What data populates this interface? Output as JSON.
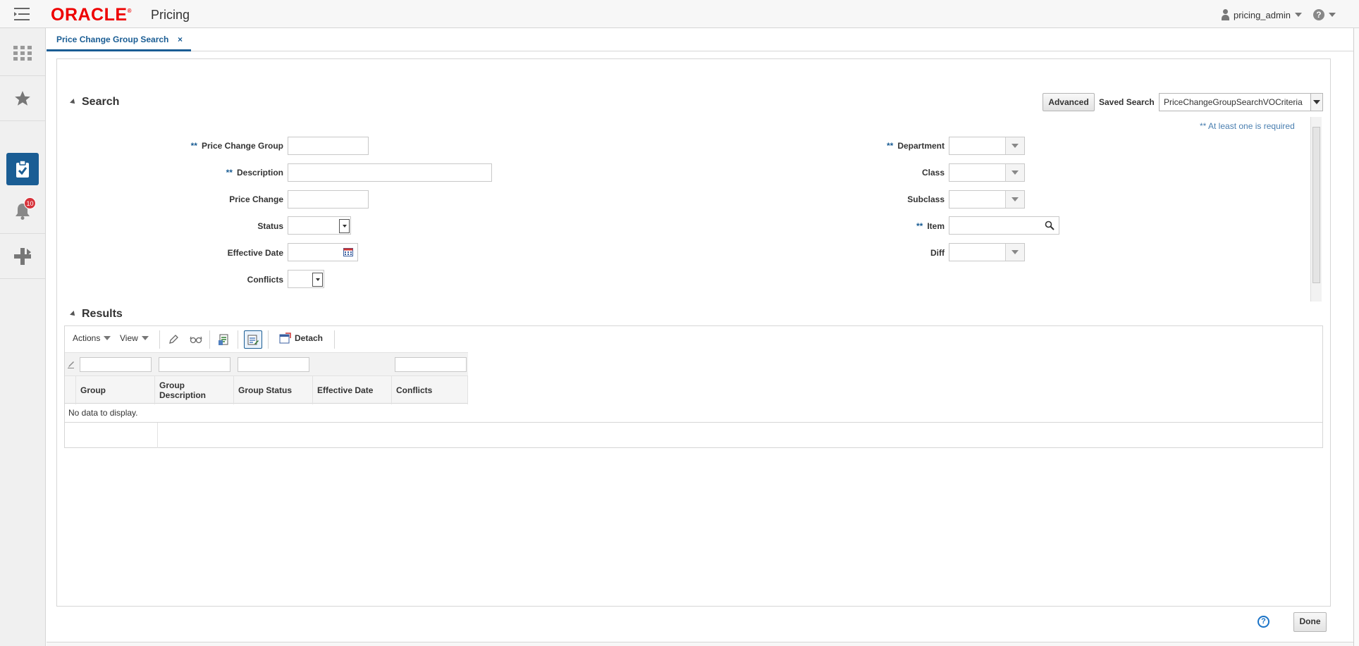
{
  "header": {
    "brand": "ORACLE",
    "app_name": "Pricing",
    "user": "pricing_admin",
    "help": "?"
  },
  "rail": {
    "items": [
      "menu-icon",
      "apps-grid-icon",
      "favorites-star-icon",
      "tasks-clipboard-icon",
      "notifications-bell-icon",
      "add-icon"
    ],
    "notification_count": "10",
    "accent": "#1a5d94"
  },
  "tab": {
    "label": "Price Change Group Search",
    "close": "×"
  },
  "search": {
    "title": "Search",
    "advanced_label": "Advanced",
    "saved_search_label": "Saved Search",
    "saved_search_value": "PriceChangeGroupSearchVOCriteria",
    "required_note": "** At least one is required",
    "req_marker": "**",
    "fields": {
      "price_change_group": "Price Change Group",
      "description": "Description",
      "price_change": "Price Change",
      "status": "Status",
      "effective_date": "Effective Date",
      "conflicts": "Conflicts",
      "department": "Department",
      "class": "Class",
      "subclass": "Subclass",
      "item": "Item",
      "diff": "Diff"
    }
  },
  "results": {
    "title": "Results",
    "toolbar": {
      "actions": "Actions",
      "view": "View",
      "detach": "Detach"
    },
    "columns": [
      "Group",
      "Group Description",
      "Group Status",
      "Effective Date",
      "Conflicts"
    ],
    "no_data": "No data to display."
  },
  "footer": {
    "help": "?",
    "done": "Done"
  }
}
